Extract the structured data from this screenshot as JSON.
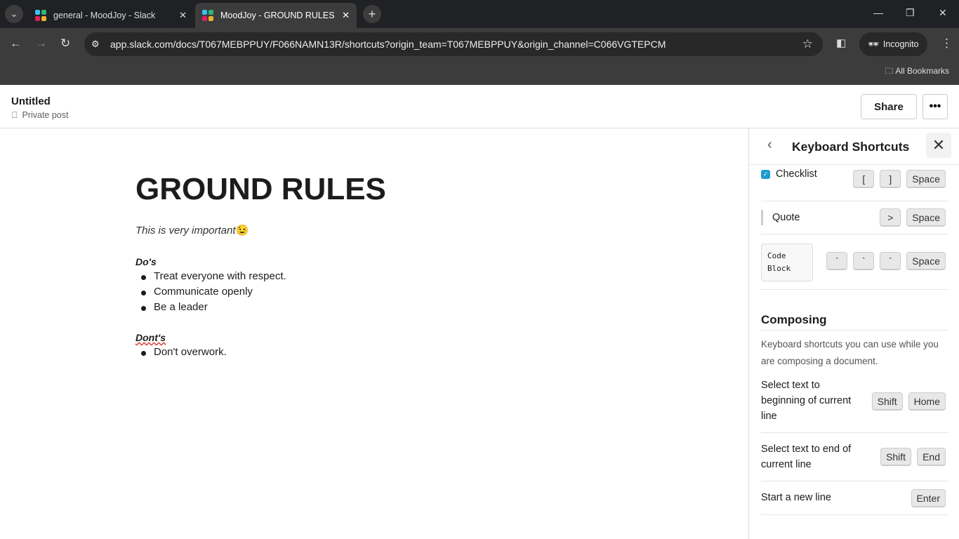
{
  "browser": {
    "tabs": [
      {
        "title": "general - MoodJoy - Slack",
        "active": false
      },
      {
        "title": "MoodJoy - GROUND RULES - Slack",
        "active": true
      }
    ],
    "url": "app.slack.com/docs/T067MEBPPUY/F066NAMN13R/shortcuts?origin_team=T067MEBPPUY&origin_channel=C066VGTEPCM",
    "incognito_label": "Incognito",
    "bookmarks_label": "All Bookmarks"
  },
  "header": {
    "title": "Untitled",
    "subtitle": "Private post",
    "share_label": "Share",
    "more_label": "•••"
  },
  "doc": {
    "heading": "GROUND RULES",
    "intro": "This is very important",
    "intro_emoji": "😉",
    "dos_heading": "Do's",
    "dos": [
      "Treat everyone with respect.",
      "Communicate openly",
      "Be a leader"
    ],
    "donts_heading": "Dont's",
    "donts": [
      "Don't overwork."
    ]
  },
  "panel": {
    "title": "Keyboard Shortcuts",
    "formatting": [
      {
        "label": "Checklist",
        "keys": [
          "[",
          "]",
          "Space"
        ]
      },
      {
        "label": "Quote",
        "keys": [
          ">",
          "Space"
        ]
      },
      {
        "label": "Code Block",
        "keys": [
          "`",
          "`",
          "`",
          "Space"
        ]
      }
    ],
    "composing_heading": "Composing",
    "composing_desc": "Keyboard shortcuts you can use while you are composing a document.",
    "composing": [
      {
        "label": "Select text to beginning of current line",
        "keys": [
          "Shift",
          "Home"
        ]
      },
      {
        "label": "Select text to end of current line",
        "keys": [
          "Shift",
          "End"
        ]
      },
      {
        "label": "Start a new line",
        "keys": [
          "Enter"
        ]
      }
    ]
  },
  "colors": {
    "checkbox": "#1d9bd1",
    "chrome_dark": "#202124"
  }
}
